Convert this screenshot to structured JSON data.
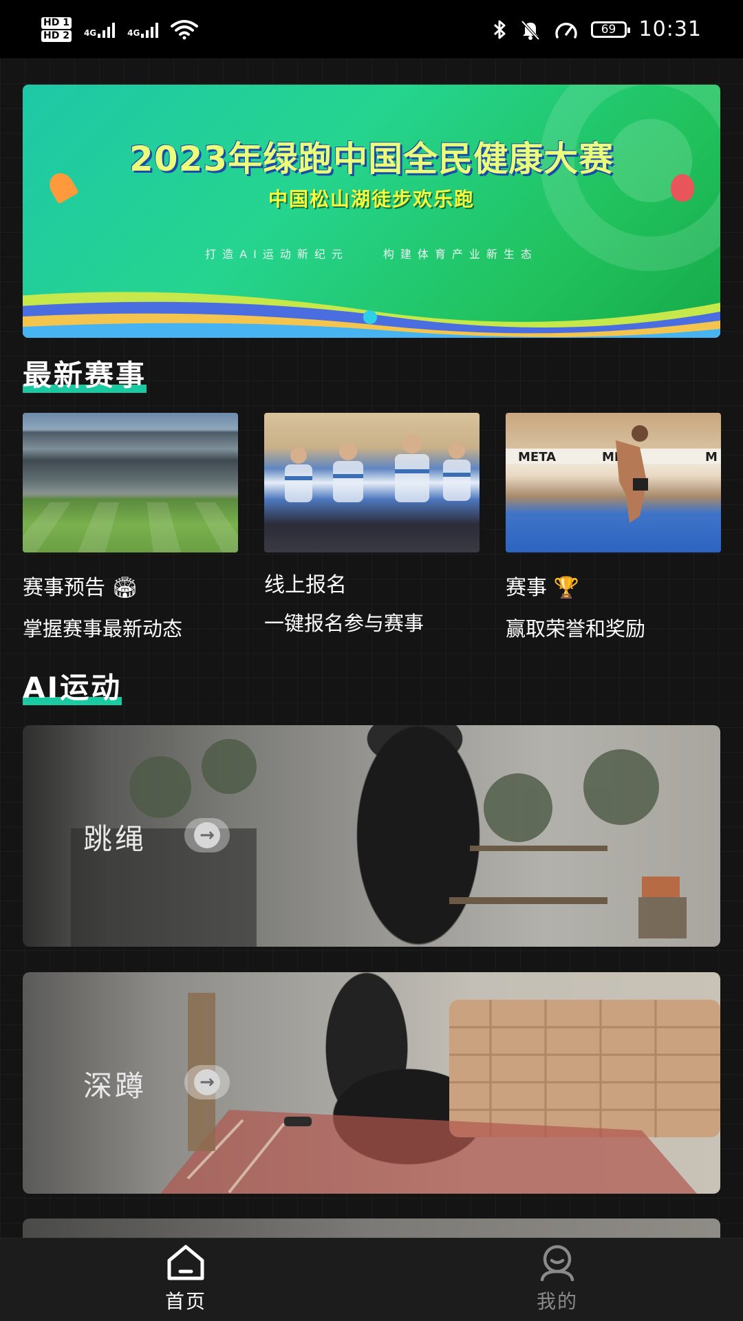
{
  "status_bar": {
    "sim1": "HD 1",
    "sim2": "HD 2",
    "network1": "4G",
    "network2": "4G",
    "battery": "69",
    "time": "10:31"
  },
  "banner": {
    "title": "2023年绿跑中国全民健康大赛",
    "subtitle": "中国松山湖徒步欢乐跑",
    "slogan": "打造AI运动新纪元　　构建体育产业新生态"
  },
  "sections": {
    "events_title": "最新赛事",
    "ai_title": "AI运动"
  },
  "events": [
    {
      "title": "赛事预告",
      "title_icon": "stadium-icon",
      "subtitle": "掌握赛事最新动态"
    },
    {
      "title": "线上报名",
      "subtitle": "一键报名参与赛事"
    },
    {
      "title": "赛事",
      "title_icon": "trophy-icon",
      "subtitle": "赢取荣誉和奖励"
    }
  ],
  "sports": [
    {
      "label": "跳绳",
      "icon": "arrow-right-icon"
    },
    {
      "label": "深蹲",
      "icon": "arrow-right-icon"
    }
  ],
  "tabs": [
    {
      "label": "首页",
      "icon": "home-icon",
      "active": true,
      "color": "#ffffff"
    },
    {
      "label": "我的",
      "icon": "profile-icon",
      "active": false,
      "color": "#8a8a8a"
    }
  ],
  "theme": {
    "background": "#141414",
    "accent": "#19c9a1"
  }
}
